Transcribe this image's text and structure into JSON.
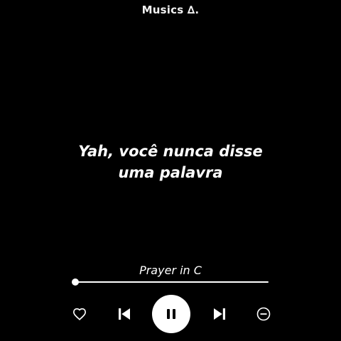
{
  "header": {
    "title": "Musics ∆."
  },
  "lyrics": {
    "lines": [
      "Yah, você nunca disse",
      "uma palavra"
    ]
  },
  "player": {
    "song_title": "Prayer in C",
    "progress": 0.0,
    "icons": {
      "like": "heart-outline-icon",
      "previous": "skip-previous-icon",
      "play_pause": "pause-icon",
      "next": "skip-next-icon",
      "remove": "minus-circle-icon"
    }
  },
  "colors": {
    "background": "#000000",
    "foreground": "#ffffff"
  }
}
